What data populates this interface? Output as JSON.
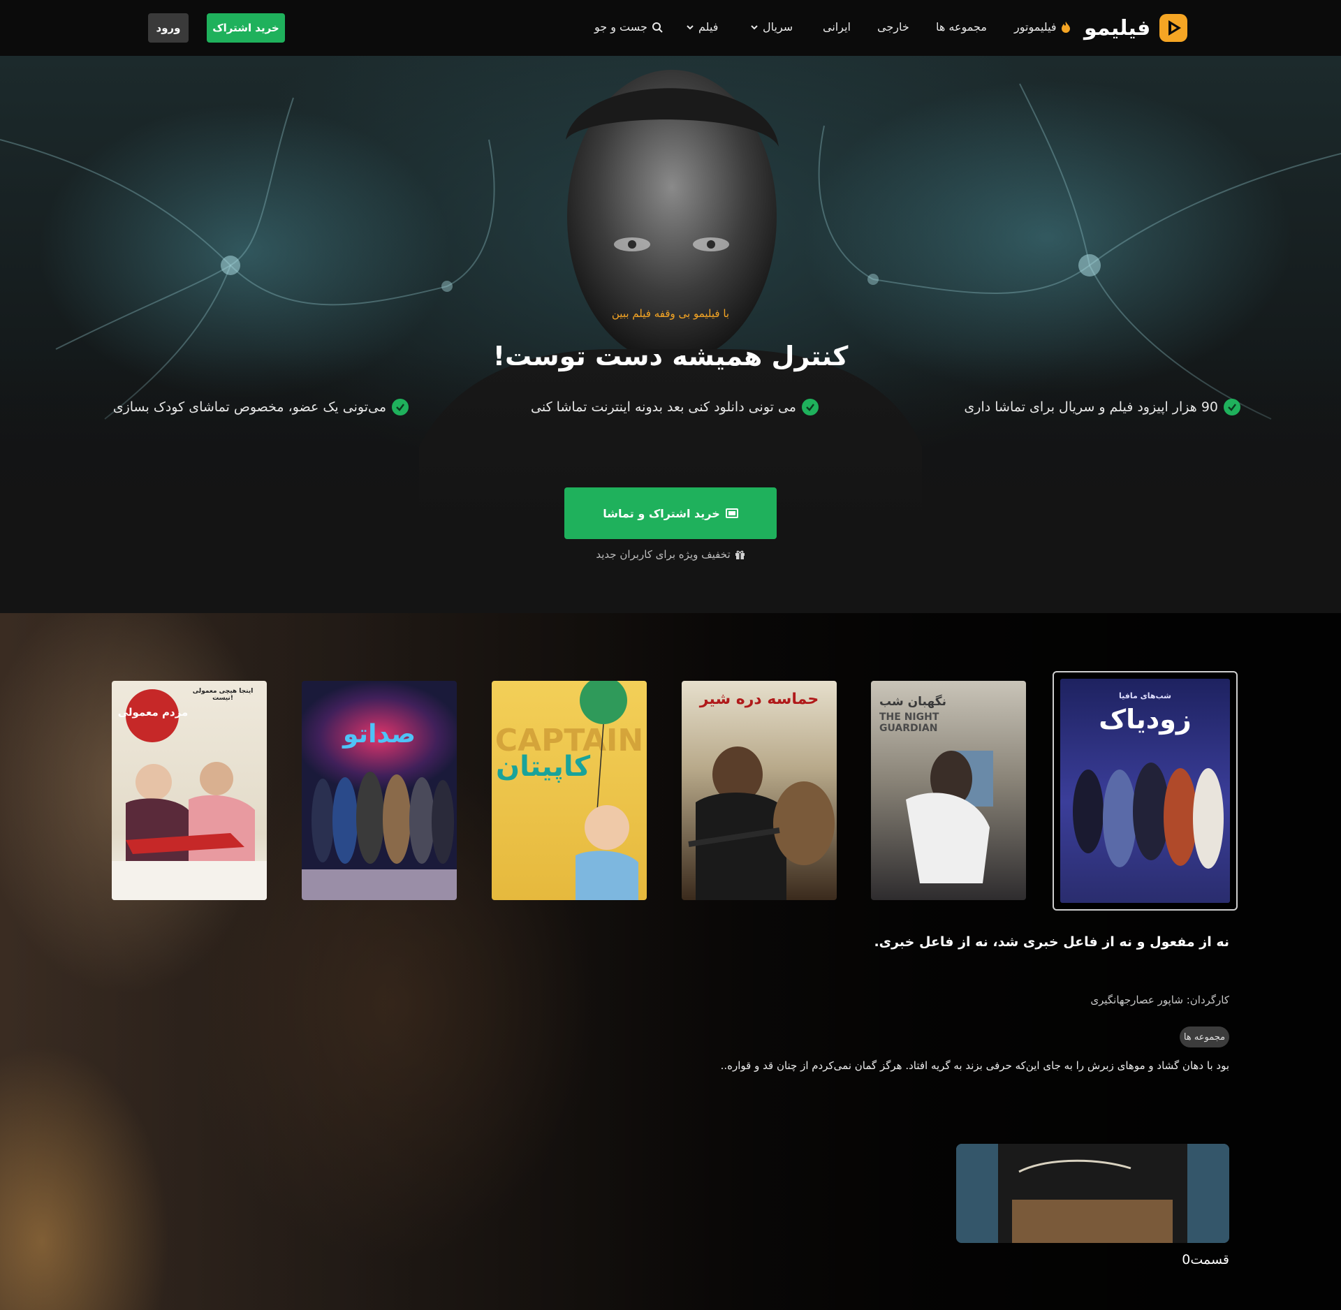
{
  "nav": {
    "brand": "فیلیمو",
    "items": {
      "filimotor": "فیلیموتور",
      "collections": "مجموعه ها",
      "foreign": "خارجی",
      "iranian": "ایرانی",
      "series": "سریال",
      "film": "فیلم",
      "search": "جست و جو"
    },
    "subscribe": "خرید اشتراک",
    "login": "ورود"
  },
  "hero": {
    "tagline": "با فیلیمو بی وقفه فیلم ببین",
    "title": "کنترل همیشه دست توست!",
    "features": [
      "90 هزار اپیزود فیلم و سریال برای تماشا داری",
      "می تونی دانلود کنی بعد بدونه اینترنت تماشا کنی",
      "می‌تونی یک عضو، مخصوص تماشای کودک بسازی"
    ],
    "cta": "خرید اشتراک و تماشا",
    "discount": "تخفیف ویژه برای کاربران جدید"
  },
  "posters": [
    {
      "title": "زودیاک",
      "subtitle": "شب‌های مافیا",
      "colors": [
        "#2a2f7a",
        "#4b3a8a"
      ]
    },
    {
      "title": "نگهبان شب",
      "subtitle": "THE NIGHT GUARDIAN",
      "colors": [
        "#a9a49a",
        "#2c2c3a"
      ]
    },
    {
      "title": "حماسه دره شیر",
      "subtitle": "",
      "colors": [
        "#d9d2c0",
        "#3b2a1d"
      ]
    },
    {
      "title": "کاپیتان",
      "subtitle": "CAPTAIN",
      "colors": [
        "#f2c94c",
        "#e0b13a"
      ]
    },
    {
      "title": "صداتو",
      "subtitle": "",
      "colors": [
        "#2a2d6e",
        "#c03a5a"
      ]
    },
    {
      "title": "مردم معمولی",
      "subtitle": "اینجا هیچی معمولی نیست!",
      "colors": [
        "#e8e3d8",
        "#c9c2b3"
      ]
    }
  ],
  "details": {
    "headline": "نه از مفعول و نه از فاعل خبری شد، نه از فاعل خبری.",
    "director": "کارگردان: شاپور عصارجهانگیری",
    "genre": "مجموعه ها",
    "synopsis": "بود با دهان گشاد و موهای زبرش را به جای این‌که حرفی بزند به گریه افتاد. هرگز گمان نمی‌کردم از چنان قد و قواره..",
    "episode_label": "قسمت0"
  }
}
